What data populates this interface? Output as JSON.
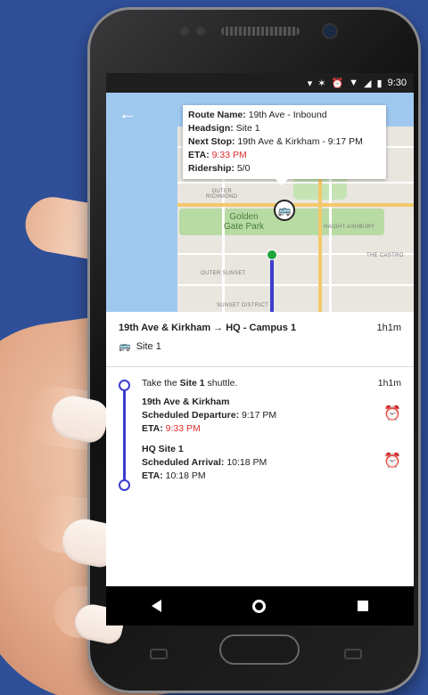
{
  "status_bar": {
    "icons": [
      "location-icon",
      "bluetooth-icon",
      "alarm-icon",
      "wifi-icon",
      "signal-icon",
      "battery-icon"
    ],
    "time": "9:30"
  },
  "map": {
    "labels": {
      "park": "Golden\nGate Park",
      "outer_richmond": "OUTER\nRICHMOND",
      "outer_sunset": "OUTER SUNSET",
      "sunset_district": "SUNSET DISTRICT",
      "haight": "HAIGHT-ASHBURY",
      "castro": "THE CASTRO"
    },
    "popup": {
      "route_name_label": "Route Name:",
      "route_name": "19th Ave - Inbound",
      "headsign_label": "Headsign:",
      "headsign": "Site 1",
      "next_stop_label": "Next Stop:",
      "next_stop": "19th Ave & Kirkham - 9:17 PM",
      "eta_label": "ETA:",
      "eta": "9:33 PM",
      "ridership_label": "Ridership:",
      "ridership": "5/0"
    }
  },
  "trip": {
    "title": "19th Ave & Kirkham → HQ - Campus 1",
    "duration": "1h1m",
    "shuttle": "Site 1"
  },
  "details": {
    "instruction_prefix": "Take the ",
    "instruction_bold": "Site 1",
    "instruction_suffix": " shuttle.",
    "duration": "1h1m",
    "origin": {
      "name": "19th Ave & Kirkham",
      "scheduled_label": "Scheduled Departure:",
      "scheduled": "9:17 PM",
      "eta_label": "ETA:",
      "eta": "9:33 PM"
    },
    "destination": {
      "name": "HQ Site 1",
      "scheduled_label": "Scheduled Arrival:",
      "scheduled": "10:18 PM",
      "eta_label": "ETA:",
      "eta": "10:18 PM"
    }
  },
  "colors": {
    "background": "#2f4f99",
    "route": "#3c3cd0",
    "late": "#e02b2b",
    "stop": "#1fa33b"
  }
}
